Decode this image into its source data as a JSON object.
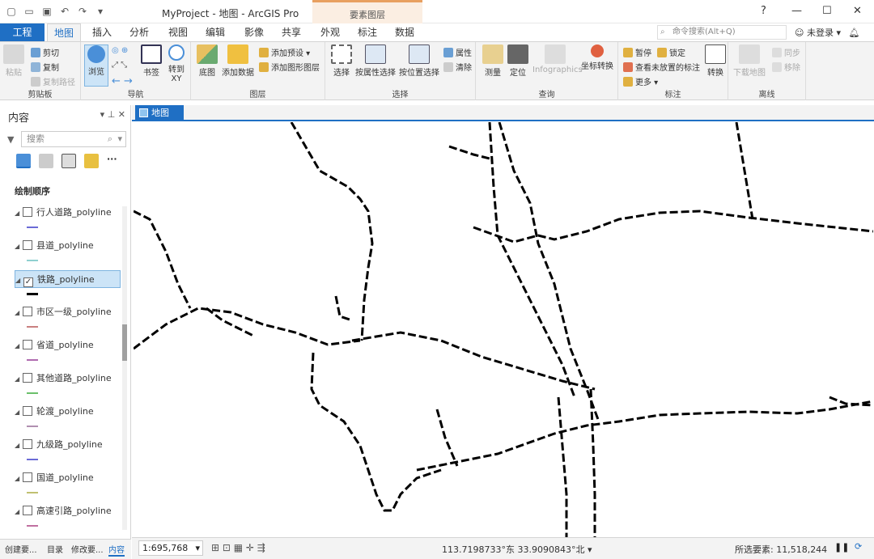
{
  "window": {
    "title": "MyProject - 地图 - ArcGIS Pro",
    "context_group": "要素图层"
  },
  "tabs": [
    "工程",
    "地图",
    "插入",
    "分析",
    "视图",
    "编辑",
    "影像",
    "共享",
    "外观",
    "标注",
    "数据"
  ],
  "command_search": {
    "placeholder": "命令搜索(Alt+Q)"
  },
  "account": "未登录",
  "ribbon": {
    "clipboard": {
      "label": "剪贴板",
      "paste": "粘贴",
      "cut": "剪切",
      "copy": "复制",
      "copy_path": "复制路径"
    },
    "navigate": {
      "label": "导航",
      "explore": "浏览",
      "bookmarks": "书签",
      "goto": "转到",
      "goto2": "XY"
    },
    "layer": {
      "label": "图层",
      "basemap": "底图",
      "add_data": "添加数据",
      "add_preset": "添加预设",
      "add_graphics": "添加图形图层"
    },
    "selection": {
      "label": "选择",
      "select": "选择",
      "by_attr": "按属性选择",
      "by_loc": "按位置选择",
      "attributes": "属性",
      "clear": "清除"
    },
    "inquiry": {
      "label": "查询",
      "measure": "测量",
      "locate": "定位",
      "infographics": "Infographics",
      "coord_convert": "坐标转换"
    },
    "labeling": {
      "label": "标注",
      "pause": "暂停",
      "lock": "锁定",
      "view_unplaced": "查看未放置的标注",
      "more": "更多",
      "convert": "转换"
    },
    "offline": {
      "label": "离线",
      "download": "下载地图",
      "sync": "同步",
      "remove": "移除"
    }
  },
  "contents": {
    "title": "内容",
    "search_placeholder": "搜索",
    "order_label": "绘制顺序",
    "layers": [
      {
        "name": "行人道路_polyline",
        "checked": false,
        "color": "#6b6bd6"
      },
      {
        "name": "县道_polyline",
        "checked": false,
        "color": "#8fd0d0"
      },
      {
        "name": "铁路_polyline",
        "checked": true,
        "color": "#000000"
      },
      {
        "name": "市区一级_polyline",
        "checked": false,
        "color": "#c98080"
      },
      {
        "name": "省道_polyline",
        "checked": false,
        "color": "#b06bb0"
      },
      {
        "name": "其他道路_polyline",
        "checked": false,
        "color": "#6bc06b"
      },
      {
        "name": "轮渡_polyline",
        "checked": false,
        "color": "#b08fb0"
      },
      {
        "name": "九级路_polyline",
        "checked": false,
        "color": "#6b6bd6"
      },
      {
        "name": "国道_polyline",
        "checked": false,
        "color": "#c0c070"
      },
      {
        "name": "高速引路_polyline",
        "checked": false,
        "color": "#c070a0"
      }
    ]
  },
  "bottom_tabs": [
    "创建要...",
    "目录",
    "修改要...",
    "内容"
  ],
  "map_tab": "地图",
  "status": {
    "scale": "1:695,768",
    "coordinates": "113.7198733°东 33.9090843°北",
    "selected": "所选要素: 11,518,244"
  }
}
